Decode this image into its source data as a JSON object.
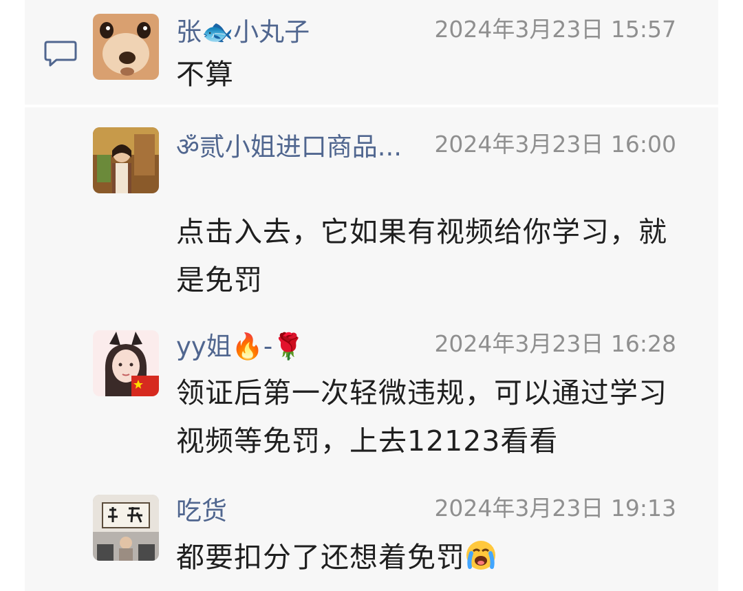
{
  "comments": [
    {
      "author": "张🐟小丸子",
      "time": "2024年3月23日 15:57",
      "text": "不算",
      "avatar_icon": "shiba-dog-avatar"
    },
    {
      "author": "ॐ贰小姐进口商品...",
      "time": "2024年3月23日 16:00",
      "text": "点击入去，它如果有视频给你学习，就是免罚",
      "avatar_icon": "woman-photo-avatar"
    },
    {
      "author": "yy姐🔥-🌹",
      "time": "2024年3月23日 16:28",
      "text": "领证后第一次轻微违规，可以通过学习视频等免罚，上去12123看看",
      "avatar_icon": "cartoon-girl-avatar"
    },
    {
      "author": "吃货",
      "time": "2024年3月23日 19:13",
      "text": "都要扣分了还想着免罚",
      "text_emoji": "loudly-crying-face-emoji",
      "avatar_icon": "calligraphy-photo-avatar"
    }
  ],
  "colors": {
    "name": "#50668f",
    "time": "#8f8f8f",
    "text": "#1f1f1f",
    "background": "#f7f7f7"
  },
  "icons": {
    "reply": "comment-bubble-icon"
  }
}
